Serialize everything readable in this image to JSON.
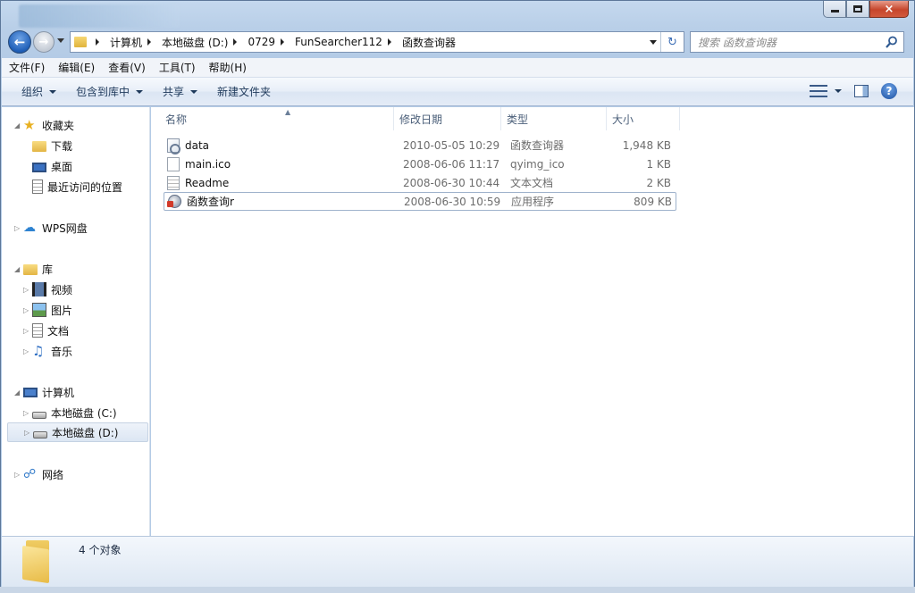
{
  "window": {
    "controls": {
      "minimize": "minimize",
      "maximize": "maximize",
      "close": "×"
    }
  },
  "address": {
    "crumbs": [
      "计算机",
      "本地磁盘 (D:)",
      "0729",
      "FunSearcher112",
      "函数查询器"
    ]
  },
  "search": {
    "placeholder": "搜索 函数查询器"
  },
  "menu": [
    "文件(F)",
    "编辑(E)",
    "查看(V)",
    "工具(T)",
    "帮助(H)"
  ],
  "toolbar": {
    "organize": "组织",
    "include_in_library": "包含到库中",
    "share": "共享",
    "new_folder": "新建文件夹"
  },
  "nav": {
    "favorites": "收藏夹",
    "downloads": "下载",
    "desktop": "桌面",
    "recent": "最近访问的位置",
    "wps": "WPS网盘",
    "libraries": "库",
    "videos": "视频",
    "pictures": "图片",
    "documents": "文档",
    "music": "音乐",
    "computer": "计算机",
    "drive_c": "本地磁盘 (C:)",
    "drive_d": "本地磁盘 (D:)",
    "network": "网络"
  },
  "columns": {
    "name": "名称",
    "date": "修改日期",
    "type": "类型",
    "size": "大小"
  },
  "files": [
    {
      "name": "data",
      "date": "2010-05-05 10:29",
      "type": "函数查询器",
      "size": "1,948 KB",
      "icon": "config-file-icon"
    },
    {
      "name": "main.ico",
      "date": "2008-06-06 11:17",
      "type": "qyimg_ico",
      "size": "1 KB",
      "icon": "blank-file-icon"
    },
    {
      "name": "Readme",
      "date": "2008-06-30 10:44",
      "type": "文本文档",
      "size": "2 KB",
      "icon": "text-file-icon"
    },
    {
      "name": "函数查询r",
      "date": "2008-06-30 10:59",
      "type": "应用程序",
      "size": "809 KB",
      "icon": "application-icon"
    }
  ],
  "status": {
    "count": "4 个对象"
  },
  "colors": {
    "accent": "#1f5fb8",
    "close": "#c6462c",
    "folder": "#e3b545"
  }
}
